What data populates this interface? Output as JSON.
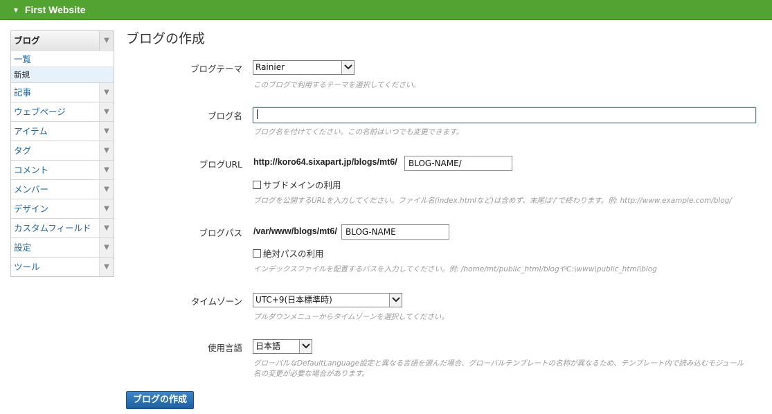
{
  "topbar": {
    "title": "First Website"
  },
  "sidebar": {
    "header": "ブログ",
    "subitems": [
      "一覧",
      "新規"
    ],
    "items": [
      "記事",
      "ウェブページ",
      "アイテム",
      "タグ",
      "コメント",
      "メンバー",
      "デザイン",
      "カスタムフィールド",
      "設定",
      "ツール"
    ]
  },
  "page": {
    "title": "ブログの作成"
  },
  "form": {
    "theme": {
      "label": "ブログテーマ",
      "value": "Rainier",
      "hint": "このブログで利用するテーマを選択してください。"
    },
    "name": {
      "label": "ブログ名",
      "value": "",
      "hint": "ブログ名を付けてください。この名前はいつでも変更できます。"
    },
    "url": {
      "label": "ブログURL",
      "prefix": "http://koro64.sixapart.jp/blogs/mt6/",
      "value": "BLOG-NAME/",
      "checkbox": "サブドメインの利用",
      "hint": "ブログを公開するURLを入力してください。ファイル名(index.htmlなど)は含めず、末尾は'/'で終わります。例: http://www.example.com/blog/"
    },
    "path": {
      "label": "ブログパス",
      "prefix": "/var/www/blogs/mt6/",
      "value": "BLOG-NAME",
      "checkbox": "絶対パスの利用",
      "hint": "インデックスファイルを配置するパスを入力してください。例: /home/mt/public_html/blogやC:\\www\\public_html\\blog"
    },
    "timezone": {
      "label": "タイムゾーン",
      "value": "UTC+9(日本標準時)",
      "hint": "プルダウンメニューからタイムゾーンを選択してください。"
    },
    "language": {
      "label": "使用言語",
      "value": "日本語",
      "hint_line1": "グローバルなDefaultLanguage設定と異なる言語を選んだ場合、グローバルテンプレートの名称が異なるため、テンプレート内で読み込むモジュール",
      "hint_line2": "名の変更が必要な場合があります。"
    }
  },
  "buttons": {
    "create": "ブログの作成"
  }
}
